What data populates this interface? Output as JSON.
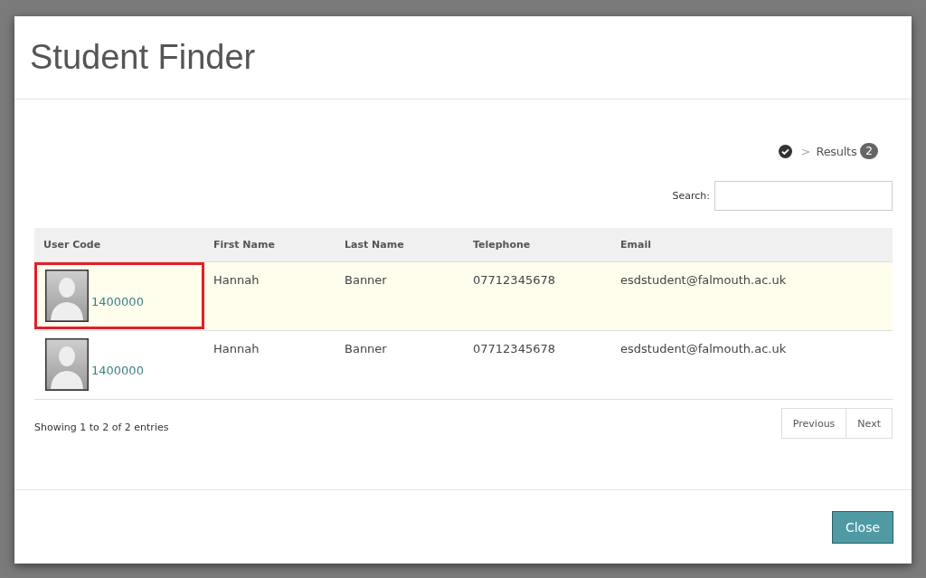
{
  "dialog": {
    "title": "Student Finder"
  },
  "breadcrumb": {
    "separator": ">",
    "label": "Results",
    "count": "2"
  },
  "search": {
    "label": "Search:"
  },
  "table": {
    "columns": [
      "User Code",
      "First Name",
      "Last Name",
      "Telephone",
      "Email"
    ],
    "rows": [
      {
        "user_code": "1400000",
        "first_name": "Hannah",
        "last_name": "Banner",
        "telephone": "07712345678",
        "email": "esdstudent@falmouth.ac.uk",
        "selected": true,
        "highlighted": true
      },
      {
        "user_code": "1400000",
        "first_name": "Hannah",
        "last_name": "Banner",
        "telephone": "07712345678",
        "email": "esdstudent@falmouth.ac.uk",
        "selected": false,
        "highlighted": false
      }
    ]
  },
  "info": "Showing 1 to 2 of 2 entries",
  "pager": [
    "Previous",
    "Next"
  ],
  "footer": {
    "button": "Close"
  }
}
